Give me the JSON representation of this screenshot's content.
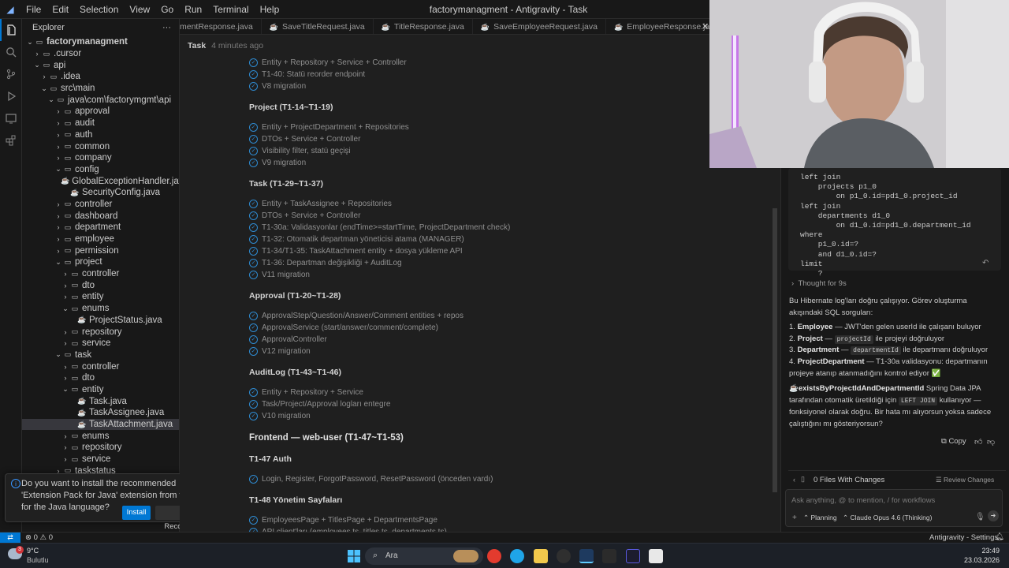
{
  "window": {
    "title": "factorymanagment - Antigravity - Task"
  },
  "menu": [
    "File",
    "Edit",
    "Selection",
    "View",
    "Go",
    "Run",
    "Terminal",
    "Help"
  ],
  "explorer": {
    "title": "Explorer",
    "more": "···",
    "rows": [
      {
        "label": "factorymanagment",
        "indent": 0,
        "type": "folder-open",
        "bold": true
      },
      {
        "label": ".cursor",
        "indent": 1,
        "type": "folder"
      },
      {
        "label": "api",
        "indent": 1,
        "type": "folder-open"
      },
      {
        "label": ".idea",
        "indent": 2,
        "type": "folder"
      },
      {
        "label": "src\\main",
        "indent": 2,
        "type": "folder-open"
      },
      {
        "label": "java\\com\\factorymgmt\\api",
        "indent": 3,
        "type": "folder-open"
      },
      {
        "label": "approval",
        "indent": 4,
        "type": "folder"
      },
      {
        "label": "audit",
        "indent": 4,
        "type": "folder"
      },
      {
        "label": "auth",
        "indent": 4,
        "type": "folder"
      },
      {
        "label": "common",
        "indent": 4,
        "type": "folder"
      },
      {
        "label": "company",
        "indent": 4,
        "type": "folder"
      },
      {
        "label": "config",
        "indent": 4,
        "type": "folder-open"
      },
      {
        "label": "GlobalExceptionHandler.java",
        "indent": 5,
        "type": "java"
      },
      {
        "label": "SecurityConfig.java",
        "indent": 5,
        "type": "java"
      },
      {
        "label": "controller",
        "indent": 4,
        "type": "folder"
      },
      {
        "label": "dashboard",
        "indent": 4,
        "type": "folder"
      },
      {
        "label": "department",
        "indent": 4,
        "type": "folder"
      },
      {
        "label": "employee",
        "indent": 4,
        "type": "folder"
      },
      {
        "label": "permission",
        "indent": 4,
        "type": "folder"
      },
      {
        "label": "project",
        "indent": 4,
        "type": "folder-open"
      },
      {
        "label": "controller",
        "indent": 5,
        "type": "folder"
      },
      {
        "label": "dto",
        "indent": 5,
        "type": "folder"
      },
      {
        "label": "entity",
        "indent": 5,
        "type": "folder"
      },
      {
        "label": "enums",
        "indent": 5,
        "type": "folder-open"
      },
      {
        "label": "ProjectStatus.java",
        "indent": 6,
        "type": "java"
      },
      {
        "label": "repository",
        "indent": 5,
        "type": "folder"
      },
      {
        "label": "service",
        "indent": 5,
        "type": "folder"
      },
      {
        "label": "task",
        "indent": 4,
        "type": "folder-open"
      },
      {
        "label": "controller",
        "indent": 5,
        "type": "folder"
      },
      {
        "label": "dto",
        "indent": 5,
        "type": "folder"
      },
      {
        "label": "entity",
        "indent": 5,
        "type": "folder-open"
      },
      {
        "label": "Task.java",
        "indent": 6,
        "type": "java"
      },
      {
        "label": "TaskAssignee.java",
        "indent": 6,
        "type": "java"
      },
      {
        "label": "TaskAttachment.java",
        "indent": 6,
        "type": "java",
        "selected": true
      },
      {
        "label": "enums",
        "indent": 5,
        "type": "folder"
      },
      {
        "label": "repository",
        "indent": 5,
        "type": "folder"
      },
      {
        "label": "service",
        "indent": 5,
        "type": "folder"
      },
      {
        "label": "taskstatus",
        "indent": 4,
        "type": "folder"
      }
    ]
  },
  "notification": {
    "message": "Do you want to install the recommended 'Extension Pack for Java' extension from vscjava for the Java language?",
    "install": "Install",
    "recommendations": "Show Recommendations"
  },
  "tabs": [
    {
      "label": "mentResponse.java",
      "icon": "java-icon"
    },
    {
      "label": "SaveTitleRequest.java",
      "icon": "java-icon"
    },
    {
      "label": "TitleResponse.java",
      "icon": "java-icon"
    },
    {
      "label": "SaveEmployeeRequest.java",
      "icon": "java-icon"
    },
    {
      "label": "EmployeeResponse.java",
      "icon": "java-icon"
    },
    {
      "label": "Task",
      "icon": "task-icon",
      "active": true
    }
  ],
  "editor": {
    "header": {
      "title": "Task",
      "time": "4 minutes ago"
    },
    "blocks": [
      {
        "kind": "item",
        "text": "Entity + Repository + Service + Controller"
      },
      {
        "kind": "item",
        "text": "T1-40: Statü reorder endpoint"
      },
      {
        "kind": "item",
        "text": "V8 migration"
      },
      {
        "kind": "gap"
      },
      {
        "kind": "h3",
        "text": "Project (T1-14~T1-19)"
      },
      {
        "kind": "gap"
      },
      {
        "kind": "item",
        "text": "Entity + ProjectDepartment + Repositories"
      },
      {
        "kind": "item",
        "text": "DTOs + Service + Controller"
      },
      {
        "kind": "item",
        "text": "Visibility filter, statü geçişi"
      },
      {
        "kind": "item",
        "text": "V9 migration"
      },
      {
        "kind": "gap"
      },
      {
        "kind": "h3",
        "text": "Task (T1-29~T1-37)"
      },
      {
        "kind": "gap"
      },
      {
        "kind": "item",
        "text": "Entity + TaskAssignee + Repositories"
      },
      {
        "kind": "item",
        "text": "DTOs + Service + Controller"
      },
      {
        "kind": "item",
        "text": "T1-30a: Validasyonlar (endTime>=startTime, ProjectDepartment check)"
      },
      {
        "kind": "item",
        "text": "T1-32: Otomatik departman yöneticisi atama (MANAGER)"
      },
      {
        "kind": "item",
        "text": "T1-34/T1-35: TaskAttachment entity + dosya yükleme API"
      },
      {
        "kind": "item",
        "text": "T1-36: Departman değişikliği + AuditLog"
      },
      {
        "kind": "item",
        "text": "V11 migration"
      },
      {
        "kind": "gap"
      },
      {
        "kind": "h3",
        "text": "Approval (T1-20~T1-28)"
      },
      {
        "kind": "gap"
      },
      {
        "kind": "item",
        "text": "ApprovalStep/Question/Answer/Comment entities + repos"
      },
      {
        "kind": "item",
        "text": "ApprovalService (start/answer/comment/complete)"
      },
      {
        "kind": "item",
        "text": "ApprovalController"
      },
      {
        "kind": "item",
        "text": "V12 migration"
      },
      {
        "kind": "gap"
      },
      {
        "kind": "h3",
        "text": "AuditLog (T1-43~T1-46)"
      },
      {
        "kind": "gap"
      },
      {
        "kind": "item",
        "text": "Entity + Repository + Service"
      },
      {
        "kind": "item",
        "text": "Task/Project/Approval logları entegre"
      },
      {
        "kind": "item",
        "text": "V10 migration"
      },
      {
        "kind": "gap"
      },
      {
        "kind": "h2",
        "text": "Frontend — web-user (T1-47~T1-53)"
      },
      {
        "kind": "gap"
      },
      {
        "kind": "h3",
        "text": "T1-47 Auth"
      },
      {
        "kind": "gap"
      },
      {
        "kind": "item",
        "text": "Login, Register, ForgotPassword, ResetPassword (önceden vardı)"
      },
      {
        "kind": "gap"
      },
      {
        "kind": "h3",
        "text": "T1-48 Yönetim Sayfaları"
      },
      {
        "kind": "gap"
      },
      {
        "kind": "item",
        "text": "EmployeesPage + TitlesPage + DepartmentsPage"
      },
      {
        "kind": "item",
        "text": "API client'ları (employees.ts, titles.ts, departments.ts)"
      }
    ]
  },
  "chat": {
    "sql_lines": [
      "left join",
      "    projects p1_0",
      "        on p1_0.id=pd1_0.project_id",
      "left join",
      "    departments d1_0",
      "        on d1_0.id=pd1_0.department_id",
      "where",
      "    p1_0.id=?",
      "    and d1_0.id=?",
      "limit",
      "    ?"
    ],
    "thought": "Thought for 9s",
    "intro": "Bu Hibernate log'ları doğru çalışıyor. Görev oluşturma akışındaki SQL sorguları:",
    "list": [
      {
        "n": "1.",
        "b": "Employee",
        "t": " — JWT'den gelen userId ile çalışanı buluyor"
      },
      {
        "n": "2.",
        "b": "Project",
        "t": " — ",
        "code": "projectId",
        "t2": " ile projeyi doğruluyor"
      },
      {
        "n": "3.",
        "b": "Department",
        "t": " — ",
        "code": "departmentId",
        "t2": " ile departmanı doğruluyor"
      },
      {
        "n": "4.",
        "b": "ProjectDepartment",
        "t": " — T1-30a validasyonu: departmanın projeye atanıp atanmadığını kontrol ediyor ✅"
      }
    ],
    "exists_name": "existsByProjectIdAndDepartmentId",
    "exists_text1": " Spring Data JPA tarafından otomatik üretildiği için ",
    "exists_code": "LEFT JOIN",
    "exists_text2": " kullanıyor — fonksiyonel olarak doğru. Bir hata mı alıyorsun yoksa sadece çalıştığını mı gösteriyorsun?",
    "copy": "Copy",
    "files_changes": "0 Files With Changes",
    "review": "Review Changes",
    "input_placeholder": "Ask anything, @ to mention, / for workflows",
    "mode": "Planning",
    "model": "Claude Opus 4.6 (Thinking)"
  },
  "statusbar": {
    "problems": "0",
    "warnings": "0",
    "right": "Antigravity - Settings"
  },
  "taskbar": {
    "weather_temp": "9°C",
    "weather_desc": "Bulutlu",
    "weather_badge": "3",
    "search": "Ara",
    "time": "23:49",
    "date": "23.03.2026"
  },
  "colors": {
    "accent": "#0078d4",
    "check": "#2e8ad0",
    "java": "#f14c4c"
  }
}
